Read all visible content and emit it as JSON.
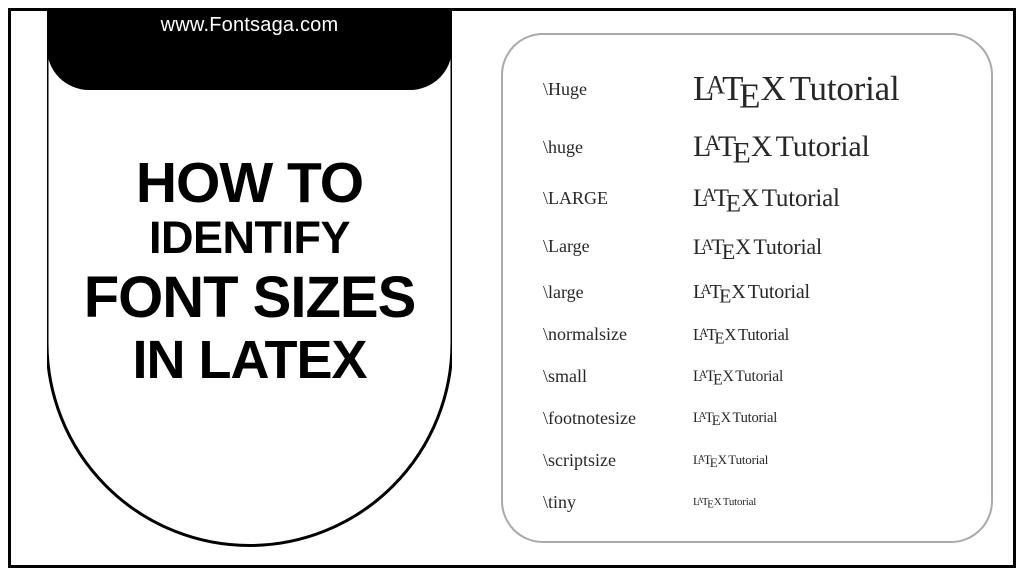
{
  "url": "www.Fontsaga.com",
  "title": {
    "line1": "HOW TO",
    "line2": "IDENTIFY",
    "line3": "FONT SIZES",
    "line4": "IN LATEX"
  },
  "sample_word": "Tutorial",
  "sizes": [
    {
      "command": "\\Huge",
      "class": "sz-Huge"
    },
    {
      "command": "\\huge",
      "class": "sz-huge"
    },
    {
      "command": "\\LARGE",
      "class": "sz-LARGE"
    },
    {
      "command": "\\Large",
      "class": "sz-Large"
    },
    {
      "command": "\\large",
      "class": "sz-large"
    },
    {
      "command": "\\normalsize",
      "class": "sz-normalsize"
    },
    {
      "command": "\\small",
      "class": "sz-small"
    },
    {
      "command": "\\footnotesize",
      "class": "sz-footnotesize"
    },
    {
      "command": "\\scriptsize",
      "class": "sz-scriptsize"
    },
    {
      "command": "\\tiny",
      "class": "sz-tiny"
    }
  ],
  "latex_letters": {
    "L": "L",
    "A": "A",
    "T": "T",
    "E": "E",
    "X": "X"
  }
}
